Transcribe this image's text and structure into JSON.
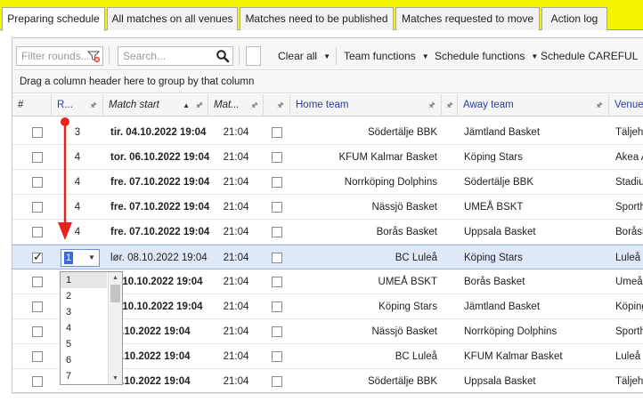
{
  "tabs": [
    {
      "label": "Preparing schedule",
      "active": true
    },
    {
      "label": "All matches on all venues",
      "active": false
    },
    {
      "label": "Matches need to be published",
      "active": false
    },
    {
      "label": "Matches requested to move",
      "active": false
    },
    {
      "label": "Action log",
      "active": false
    }
  ],
  "toolbar": {
    "filter_placeholder": "Filter rounds...",
    "search_placeholder": "Search...",
    "clear_all": "Clear all",
    "team_functions": "Team functions",
    "schedule_functions": "Schedule functions",
    "schedule_careful": "Schedule CAREFUL"
  },
  "group_hint": "Drag a column header here to group by that column",
  "columns": {
    "num": "#",
    "round": "R...",
    "match_start": "Match start",
    "match_end": "Mat...",
    "home_team": "Home team",
    "away_team": "Away team",
    "venue": "Venue"
  },
  "rows": [
    {
      "checked": false,
      "round": "3",
      "start": "tir. 04.10.2022 19:04",
      "bold": true,
      "end": "21:04",
      "home": "Södertälje BBK",
      "away": "Jämtland Basket",
      "venue": "Täljehal"
    },
    {
      "checked": false,
      "round": "4",
      "start": "tor. 06.10.2022 19:04",
      "bold": true,
      "end": "21:04",
      "home": "KFUM Kalmar Basket",
      "away": "Köping Stars",
      "venue": "Akea A"
    },
    {
      "checked": false,
      "round": "4",
      "start": "fre. 07.10.2022 19:04",
      "bold": true,
      "end": "21:04",
      "home": "Norrköping Dolphins",
      "away": "Södertälje BBK",
      "venue": "Stadiu"
    },
    {
      "checked": false,
      "round": "4",
      "start": "fre. 07.10.2022 19:04",
      "bold": true,
      "end": "21:04",
      "home": "Nässjö Basket",
      "away": "UMEÅ BSKT",
      "venue": "Sporth"
    },
    {
      "checked": false,
      "round": "4",
      "start": "fre. 07.10.2022 19:04",
      "bold": true,
      "end": "21:04",
      "home": "Borås Basket",
      "away": "Uppsala Basket",
      "venue": "Boråsh"
    },
    {
      "checked": true,
      "round": "1",
      "start": "lør. 08.10.2022 19:04",
      "bold": false,
      "end": "21:04",
      "home": "BC Luleå",
      "away": "Köping Stars",
      "venue": "Luleå E",
      "selected": true
    },
    {
      "checked": false,
      "round": "",
      "start": "n. 10.10.2022 19:04",
      "bold": true,
      "end": "21:04",
      "home": "UMEÅ BSKT",
      "away": "Borås Basket",
      "venue": "Umeå"
    },
    {
      "checked": false,
      "round": "",
      "start": "n. 10.10.2022 19:04",
      "bold": true,
      "end": "21:04",
      "home": "Köping Stars",
      "away": "Jämtland Basket",
      "venue": "Köping"
    },
    {
      "checked": false,
      "round": "",
      "start": "11.10.2022 19:04",
      "bold": true,
      "end": "21:04",
      "home": "Nässjö Basket",
      "away": "Norrköping Dolphins",
      "venue": "Sporth"
    },
    {
      "checked": false,
      "round": "",
      "start": "11.10.2022 19:04",
      "bold": true,
      "end": "21:04",
      "home": "BC Luleå",
      "away": "KFUM Kalmar Basket",
      "venue": "Luleå"
    },
    {
      "checked": false,
      "round": "5",
      "start": "11.10.2022 19:04",
      "bold": true,
      "end": "21:04",
      "home": "Södertälje BBK",
      "away": "Uppsala Basket",
      "venue": "Täljeh"
    }
  ],
  "round_editor": {
    "value": "1"
  },
  "round_options": [
    "1",
    "2",
    "3",
    "4",
    "5",
    "6",
    "7"
  ],
  "accent_color": "#e8231e"
}
